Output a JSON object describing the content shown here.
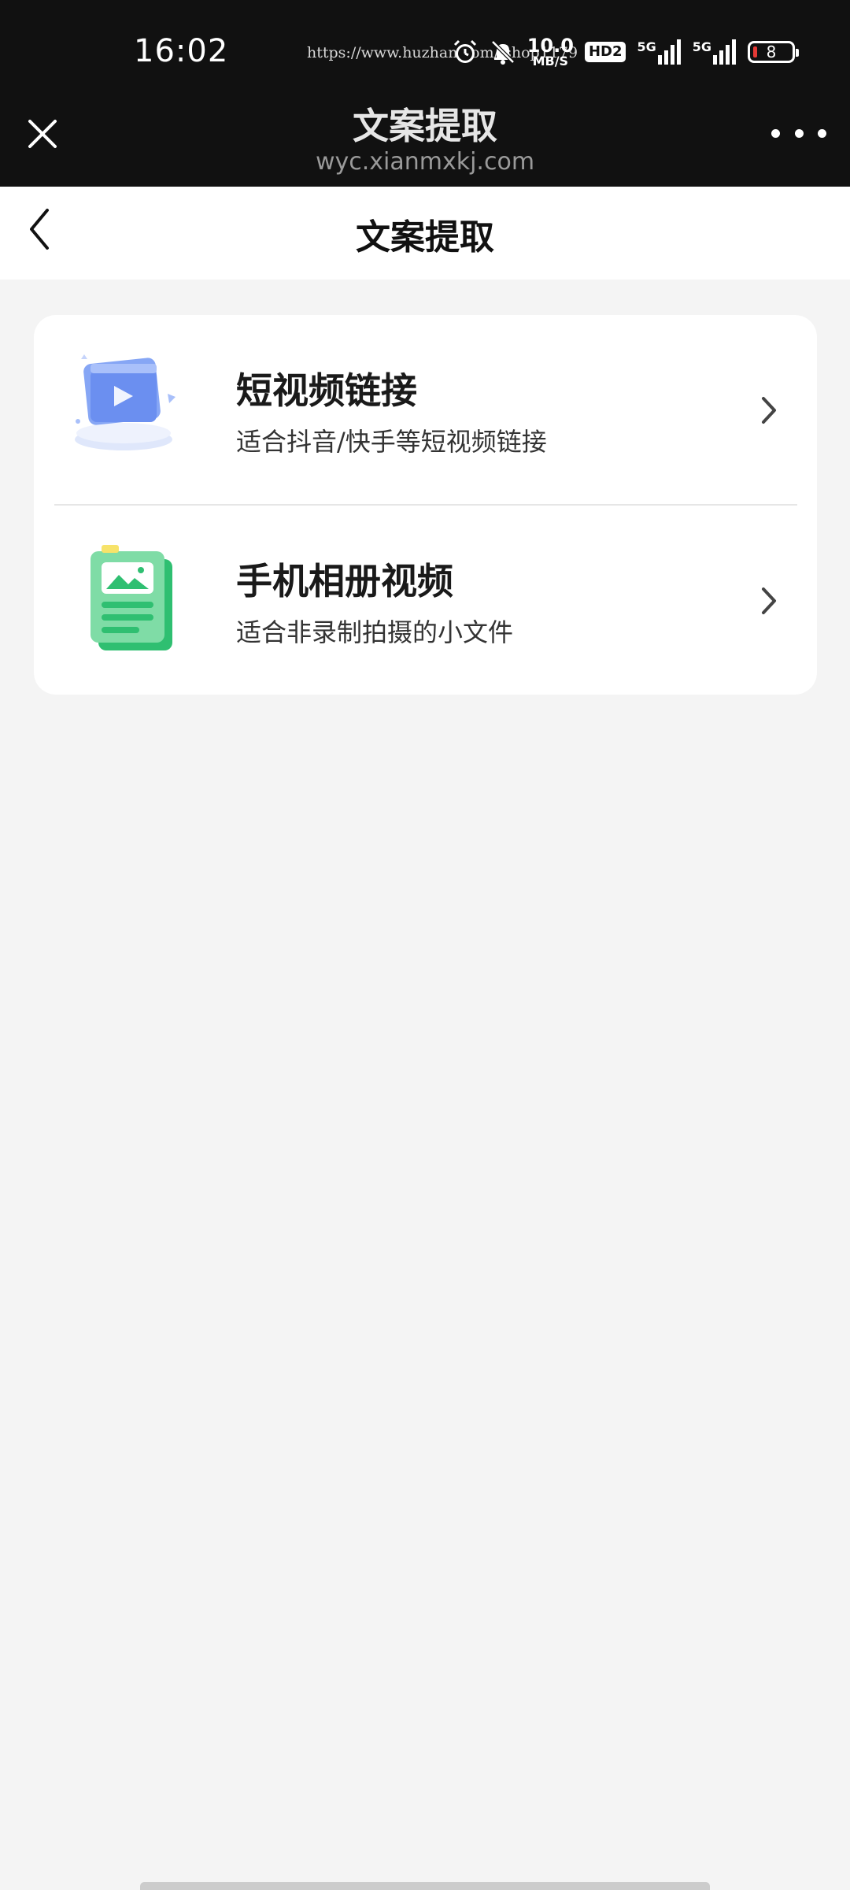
{
  "status_bar": {
    "time": "16:02",
    "watermark": "https://www.huzhan.com/ishop1179",
    "speed_value": "10.0",
    "speed_unit": "MB/S",
    "hd_badge": "HD2",
    "network_1": "5G",
    "network_2": "5G",
    "battery_level": "8"
  },
  "browser": {
    "title": "文案提取",
    "url": "wyc.xianmxkj.com"
  },
  "page": {
    "title": "文案提取"
  },
  "options": [
    {
      "title": "短视频链接",
      "subtitle": "适合抖音/快手等短视频链接",
      "icon": "video-link-icon"
    },
    {
      "title": "手机相册视频",
      "subtitle": "适合非录制拍摄的小文件",
      "icon": "album-video-icon"
    }
  ],
  "colors": {
    "status_bar_bg": "#111111",
    "page_bg": "#f4f4f4",
    "card_bg": "#ffffff",
    "icon_blue": "#6b8ff0",
    "icon_green": "#2fbf71"
  }
}
